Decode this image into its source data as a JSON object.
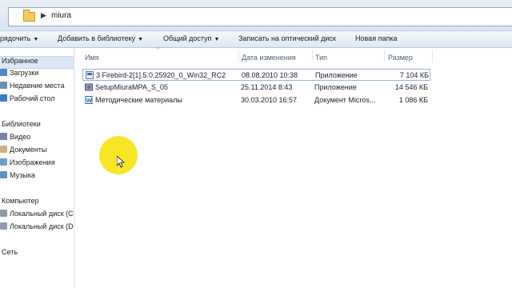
{
  "address": {
    "folder": "miura"
  },
  "toolbar": [
    {
      "label": "рядочить",
      "has_arrow": true
    },
    {
      "label": "Добавить в библиотеку",
      "has_arrow": true
    },
    {
      "label": "Общий доступ",
      "has_arrow": true
    },
    {
      "label": "Записать на оптический диск",
      "has_arrow": false
    },
    {
      "label": "Новая папка",
      "has_arrow": false
    }
  ],
  "nav": {
    "favorites": "Избранное",
    "favorites_items": [
      "Загрузки",
      "Недавние места",
      "Рабочий стол"
    ],
    "libraries": "Библиотеки",
    "libraries_items": [
      "Видео",
      "Документы",
      "Изображения",
      "Музыка"
    ],
    "computer": "Компьютер",
    "computer_items": [
      "Локальный диск (C",
      "Локальный диск (D"
    ],
    "network": "Сеть"
  },
  "columns": {
    "name": "Имя",
    "date": "Дата изменения",
    "type": "Тип",
    "size": "Размер"
  },
  "files": [
    {
      "name": "3 Firebird-2[1].5.0.25920_0_Win32_RC2",
      "date": "08.08.2010 10:38",
      "type": "Приложение",
      "size": "7 104 КБ",
      "icon": "installer-icon",
      "selected": true
    },
    {
      "name": "SetupMiuraMPA_S_05",
      "date": "25.11.2014 8:43",
      "type": "Приложение",
      "size": "14 546 КБ",
      "icon": "setup-icon",
      "selected": false
    },
    {
      "name": "Методические материалы",
      "date": "30.03.2010 16:57",
      "type": "Документ Micros...",
      "size": "1 086 КБ",
      "icon": "word-doc-icon",
      "selected": false
    }
  ],
  "colors": {
    "highlight": "#f7e51a",
    "selection_border": "#9ab4d6"
  }
}
